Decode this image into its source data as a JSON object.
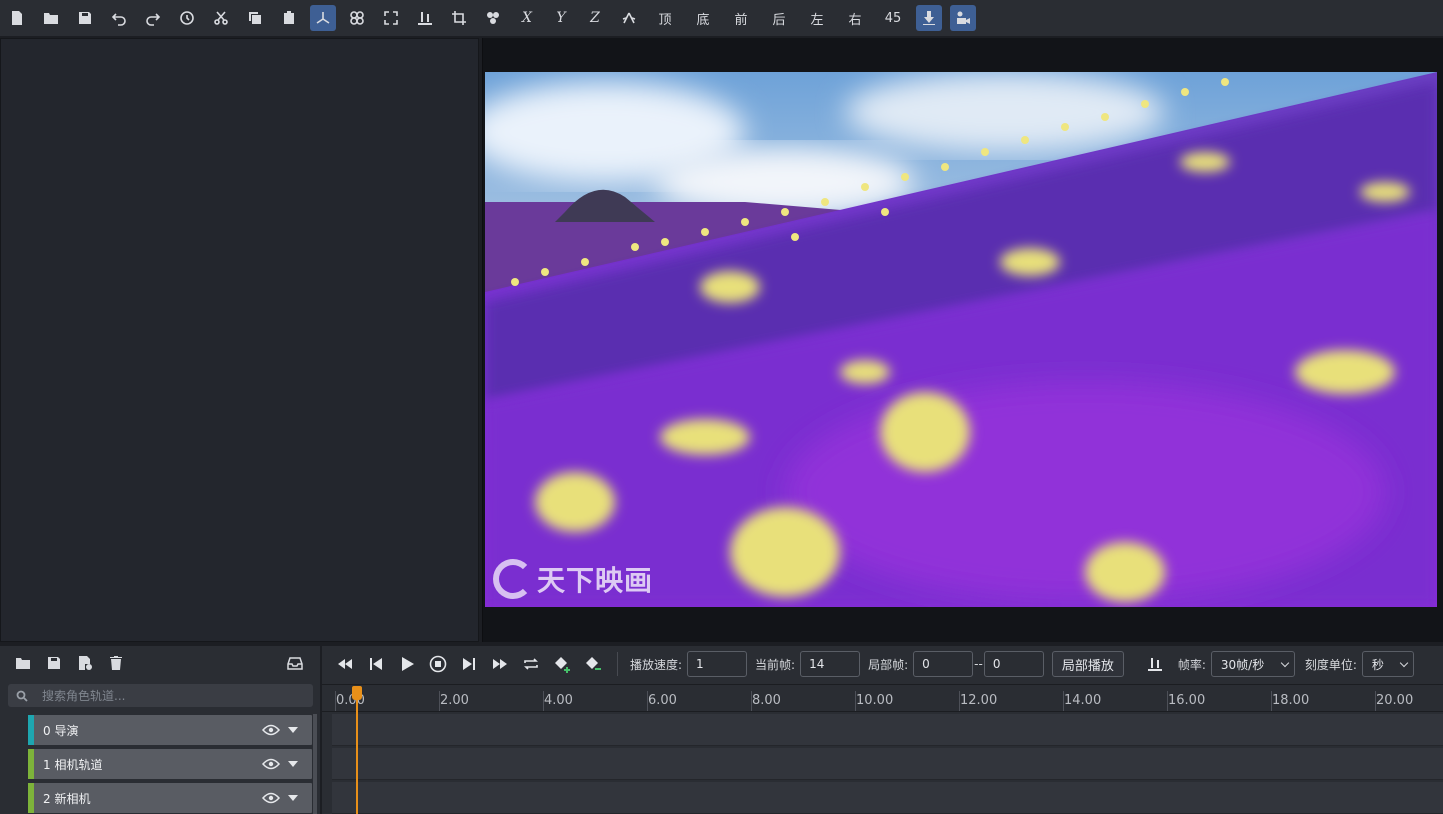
{
  "toolbar": {
    "axis_x": "X",
    "axis_y": "Y",
    "axis_z": "Z",
    "view_top": "顶",
    "view_bottom": "底",
    "view_front": "前",
    "view_back": "后",
    "view_left": "左",
    "view_right": "右",
    "view_45": "45"
  },
  "viewport": {
    "watermark": "天下映画"
  },
  "tracks": {
    "search_placeholder": "搜索角色轨道...",
    "items": [
      {
        "label": "0 导演",
        "color": "#1ea6b0"
      },
      {
        "label": "1 相机轨道",
        "color": "#7db33a"
      },
      {
        "label": "2 新相机",
        "color": "#7db33a"
      }
    ]
  },
  "timeline": {
    "speed_label": "播放速度:",
    "speed_value": "1",
    "current_frame_label": "当前帧:",
    "current_frame_value": "14",
    "local_frame_label": "局部帧:",
    "local_from": "0",
    "range_sep": "--",
    "local_to": "0",
    "local_play_button": "局部播放",
    "fps_label": "帧率:",
    "fps_value": "30帧/秒",
    "unit_label": "刻度单位:",
    "unit_value": "秒",
    "ruler": [
      "0.00",
      "2.00",
      "4.00",
      "6.00",
      "8.00",
      "10.00",
      "12.00",
      "14.00",
      "16.00",
      "18.00",
      "20.00"
    ]
  },
  "colors": {
    "accent": "#3e5f94",
    "playhead": "#e8901a"
  }
}
